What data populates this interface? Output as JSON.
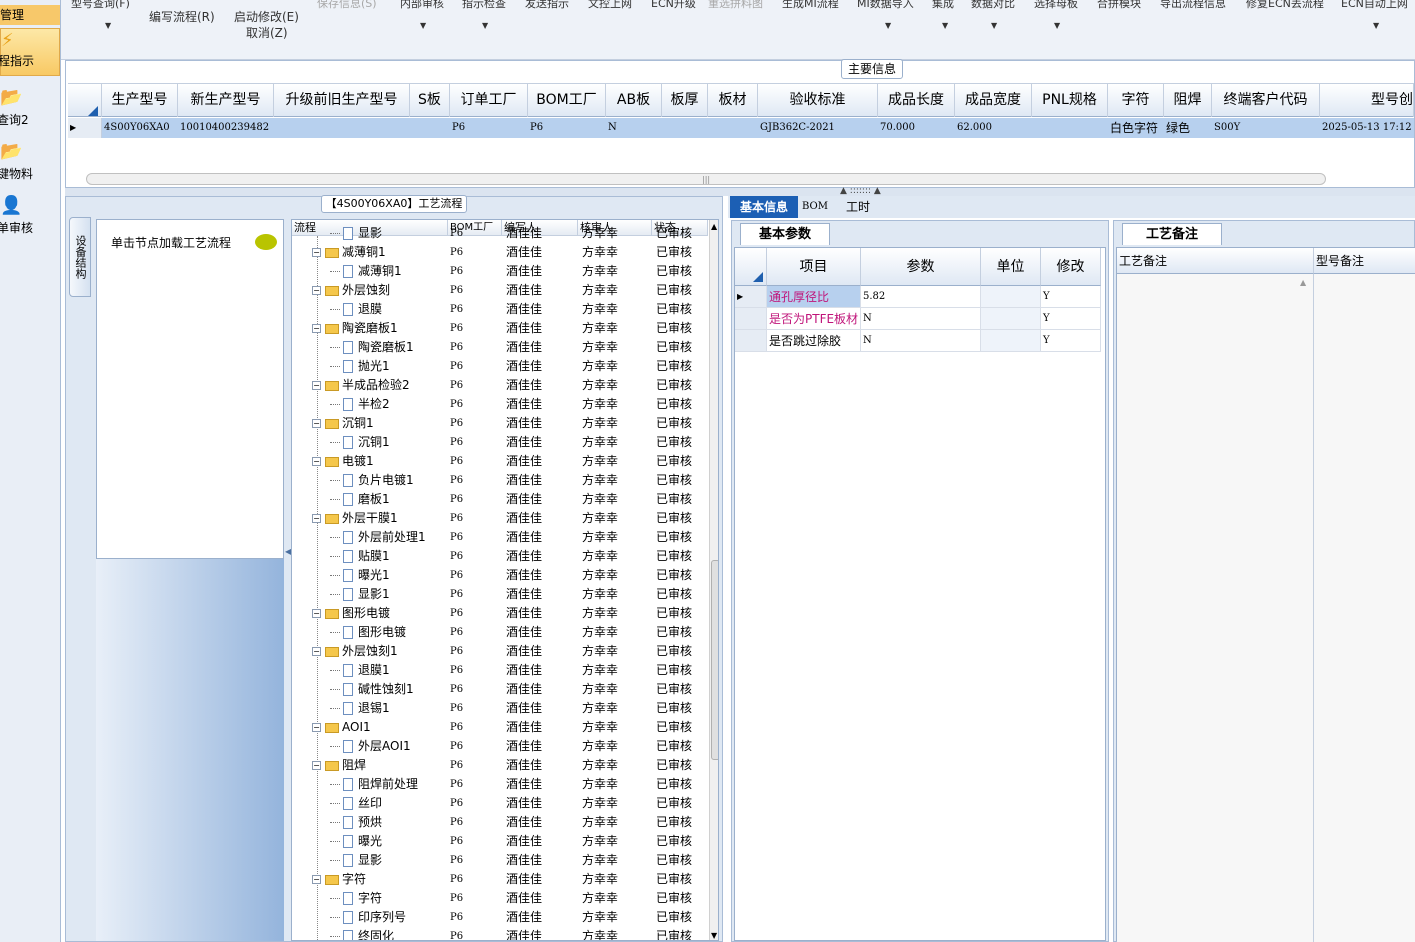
{
  "leftnav": {
    "header": "管理",
    "items": [
      {
        "label": "程指示",
        "selected": true
      },
      {
        "label": "查询2",
        "selected": false
      },
      {
        "label": "键物料",
        "selected": false
      },
      {
        "label": "单审核",
        "selected": false
      }
    ]
  },
  "toolbar": {
    "buttons": [
      {
        "label": "型号查询(F)",
        "enabled": true,
        "dropdown": true
      },
      {
        "label": "编写流程(R)",
        "enabled": true,
        "dropdown": false
      },
      {
        "label": "启动修改(E)",
        "enabled": true,
        "dropdown": false
      },
      {
        "label": "保存信息(S)",
        "enabled": false,
        "dropdown": false
      },
      {
        "label": "内部审核",
        "enabled": true,
        "dropdown": true
      },
      {
        "label": "指示检查",
        "enabled": true,
        "dropdown": true
      },
      {
        "label": "发送指示",
        "enabled": true,
        "dropdown": false
      },
      {
        "label": "文控上网",
        "enabled": true,
        "dropdown": false
      },
      {
        "label": "ECN升级",
        "enabled": true,
        "dropdown": false
      },
      {
        "label": "重选拼料图",
        "enabled": false,
        "dropdown": false
      },
      {
        "label": "生成MI流程",
        "enabled": true,
        "dropdown": false
      },
      {
        "label": "MI数据导入",
        "enabled": true,
        "dropdown": true
      },
      {
        "label": "集成",
        "enabled": true,
        "dropdown": true
      },
      {
        "label": "数据对比",
        "enabled": true,
        "dropdown": true
      },
      {
        "label": "选择母板",
        "enabled": true,
        "dropdown": true
      },
      {
        "label": "合拼模块",
        "enabled": true,
        "dropdown": false
      },
      {
        "label": "导出流程信息",
        "enabled": true,
        "dropdown": false
      },
      {
        "label": "修复ECN丢流程",
        "enabled": true,
        "dropdown": false
      },
      {
        "label": "ECN自动上网",
        "enabled": true,
        "dropdown": true
      }
    ],
    "cancel_label": "取消(Z)"
  },
  "main_info": {
    "caption": "主要信息",
    "columns": [
      "生产型号",
      "新生产型号",
      "升级前旧生产型号",
      "S板",
      "订单工厂",
      "BOM工厂",
      "AB板",
      "板厚",
      "板材",
      "验收标准",
      "成品长度",
      "成品宽度",
      "PNL规格",
      "字符",
      "阻焊",
      "终端客户代码",
      "型号创"
    ],
    "row": [
      "4S00Y06XA0",
      "10010400239482",
      "",
      "",
      "P6",
      "P6",
      "N",
      "",
      "",
      "GJB362C-2021",
      "70.000",
      "62.000",
      "",
      "白色字符",
      "绿色",
      "S00Y",
      "2025-05-13 17:12"
    ]
  },
  "process": {
    "caption": "【4S00Y06XA0】工艺流程",
    "side_tab": "设备结构",
    "nav_hint": "单击节点加载工艺流程",
    "columns": [
      "流程",
      "BOM工厂",
      "编写人",
      "核审人",
      "状态"
    ],
    "rows": [
      {
        "name": "显影",
        "level": 2,
        "factory": "P6",
        "writer": "酒佳佳",
        "reviewer": "方幸幸",
        "status": "已审核"
      },
      {
        "name": "减薄铜1",
        "level": 1,
        "factory": "P6",
        "writer": "酒佳佳",
        "reviewer": "方幸幸",
        "status": "已审核"
      },
      {
        "name": "减薄铜1",
        "level": 2,
        "factory": "P6",
        "writer": "酒佳佳",
        "reviewer": "方幸幸",
        "status": "已审核"
      },
      {
        "name": "外层蚀刻",
        "level": 1,
        "factory": "P6",
        "writer": "酒佳佳",
        "reviewer": "方幸幸",
        "status": "已审核"
      },
      {
        "name": "退膜",
        "level": 2,
        "factory": "P6",
        "writer": "酒佳佳",
        "reviewer": "方幸幸",
        "status": "已审核"
      },
      {
        "name": "陶瓷磨板1",
        "level": 1,
        "factory": "P6",
        "writer": "酒佳佳",
        "reviewer": "方幸幸",
        "status": "已审核"
      },
      {
        "name": "陶瓷磨板1",
        "level": 2,
        "factory": "P6",
        "writer": "酒佳佳",
        "reviewer": "方幸幸",
        "status": "已审核"
      },
      {
        "name": "抛光1",
        "level": 2,
        "factory": "P6",
        "writer": "酒佳佳",
        "reviewer": "方幸幸",
        "status": "已审核"
      },
      {
        "name": "半成品检验2",
        "level": 1,
        "factory": "P6",
        "writer": "酒佳佳",
        "reviewer": "方幸幸",
        "status": "已审核"
      },
      {
        "name": "半检2",
        "level": 2,
        "factory": "P6",
        "writer": "酒佳佳",
        "reviewer": "方幸幸",
        "status": "已审核"
      },
      {
        "name": "沉铜1",
        "level": 1,
        "factory": "P6",
        "writer": "酒佳佳",
        "reviewer": "方幸幸",
        "status": "已审核"
      },
      {
        "name": "沉铜1",
        "level": 2,
        "factory": "P6",
        "writer": "酒佳佳",
        "reviewer": "方幸幸",
        "status": "已审核"
      },
      {
        "name": "电镀1",
        "level": 1,
        "factory": "P6",
        "writer": "酒佳佳",
        "reviewer": "方幸幸",
        "status": "已审核"
      },
      {
        "name": "负片电镀1",
        "level": 2,
        "factory": "P6",
        "writer": "酒佳佳",
        "reviewer": "方幸幸",
        "status": "已审核"
      },
      {
        "name": "磨板1",
        "level": 2,
        "factory": "P6",
        "writer": "酒佳佳",
        "reviewer": "方幸幸",
        "status": "已审核"
      },
      {
        "name": "外层干膜1",
        "level": 1,
        "factory": "P6",
        "writer": "酒佳佳",
        "reviewer": "方幸幸",
        "status": "已审核"
      },
      {
        "name": "外层前处理1",
        "level": 2,
        "factory": "P6",
        "writer": "酒佳佳",
        "reviewer": "方幸幸",
        "status": "已审核"
      },
      {
        "name": "贴膜1",
        "level": 2,
        "factory": "P6",
        "writer": "酒佳佳",
        "reviewer": "方幸幸",
        "status": "已审核"
      },
      {
        "name": "曝光1",
        "level": 2,
        "factory": "P6",
        "writer": "酒佳佳",
        "reviewer": "方幸幸",
        "status": "已审核"
      },
      {
        "name": "显影1",
        "level": 2,
        "factory": "P6",
        "writer": "酒佳佳",
        "reviewer": "方幸幸",
        "status": "已审核"
      },
      {
        "name": "图形电镀",
        "level": 1,
        "factory": "P6",
        "writer": "酒佳佳",
        "reviewer": "方幸幸",
        "status": "已审核"
      },
      {
        "name": "图形电镀",
        "level": 2,
        "factory": "P6",
        "writer": "酒佳佳",
        "reviewer": "方幸幸",
        "status": "已审核"
      },
      {
        "name": "外层蚀刻1",
        "level": 1,
        "factory": "P6",
        "writer": "酒佳佳",
        "reviewer": "方幸幸",
        "status": "已审核"
      },
      {
        "name": "退膜1",
        "level": 2,
        "factory": "P6",
        "writer": "酒佳佳",
        "reviewer": "方幸幸",
        "status": "已审核"
      },
      {
        "name": "碱性蚀刻1",
        "level": 2,
        "factory": "P6",
        "writer": "酒佳佳",
        "reviewer": "方幸幸",
        "status": "已审核"
      },
      {
        "name": "退锡1",
        "level": 2,
        "factory": "P6",
        "writer": "酒佳佳",
        "reviewer": "方幸幸",
        "status": "已审核"
      },
      {
        "name": "AOI1",
        "level": 1,
        "factory": "P6",
        "writer": "酒佳佳",
        "reviewer": "方幸幸",
        "status": "已审核"
      },
      {
        "name": "外层AOI1",
        "level": 2,
        "factory": "P6",
        "writer": "酒佳佳",
        "reviewer": "方幸幸",
        "status": "已审核"
      },
      {
        "name": "阻焊",
        "level": 1,
        "factory": "P6",
        "writer": "酒佳佳",
        "reviewer": "方幸幸",
        "status": "已审核"
      },
      {
        "name": "阻焊前处理",
        "level": 2,
        "factory": "P6",
        "writer": "酒佳佳",
        "reviewer": "方幸幸",
        "status": "已审核"
      },
      {
        "name": "丝印",
        "level": 2,
        "factory": "P6",
        "writer": "酒佳佳",
        "reviewer": "方幸幸",
        "status": "已审核"
      },
      {
        "name": "预烘",
        "level": 2,
        "factory": "P6",
        "writer": "酒佳佳",
        "reviewer": "方幸幸",
        "status": "已审核"
      },
      {
        "name": "曝光",
        "level": 2,
        "factory": "P6",
        "writer": "酒佳佳",
        "reviewer": "方幸幸",
        "status": "已审核"
      },
      {
        "name": "显影",
        "level": 2,
        "factory": "P6",
        "writer": "酒佳佳",
        "reviewer": "方幸幸",
        "status": "已审核"
      },
      {
        "name": "字符",
        "level": 1,
        "factory": "P6",
        "writer": "酒佳佳",
        "reviewer": "方幸幸",
        "status": "已审核"
      },
      {
        "name": "字符",
        "level": 2,
        "factory": "P6",
        "writer": "酒佳佳",
        "reviewer": "方幸幸",
        "status": "已审核"
      },
      {
        "name": "印序列号",
        "level": 2,
        "factory": "P6",
        "writer": "酒佳佳",
        "reviewer": "方幸幸",
        "status": "已审核"
      },
      {
        "name": "终固化",
        "level": 2,
        "factory": "P6",
        "writer": "酒佳佳",
        "reviewer": "方幸幸",
        "status": "已审核"
      }
    ]
  },
  "right_tabs": [
    {
      "label": "基本信息",
      "active": true
    },
    {
      "label": "BOM",
      "active": false
    },
    {
      "label": "工时",
      "active": false
    }
  ],
  "basic_params": {
    "tab": "基本参数",
    "columns": [
      "项目",
      "参数",
      "单位",
      "修改"
    ],
    "rows": [
      {
        "item": "通孔厚径比",
        "value": "5.82",
        "unit": "",
        "edit": "Y",
        "highlight": true
      },
      {
        "item": "是否为PTFE板材",
        "value": "N",
        "unit": "",
        "edit": "Y",
        "highlight": true
      },
      {
        "item": "是否跳过除胶",
        "value": "N",
        "unit": "",
        "edit": "Y",
        "highlight": false
      }
    ]
  },
  "remarks": {
    "tab": "工艺备注",
    "columns": [
      "工艺备注",
      "型号备注"
    ]
  },
  "colors": {
    "selected_row": "#b7d0ee",
    "active_tab": "#1c5fb4",
    "highlight_text": "#c0147a"
  }
}
